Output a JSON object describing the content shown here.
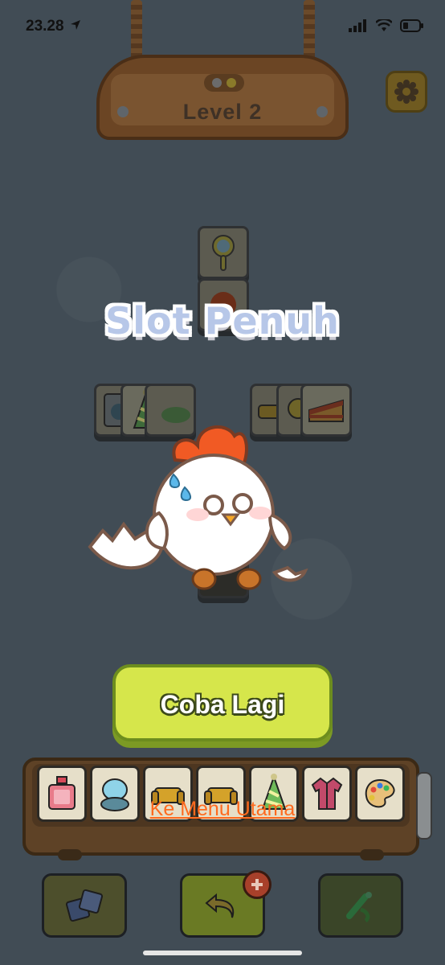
{
  "status_bar": {
    "time": "23.28"
  },
  "header": {
    "level_label": "Level 2"
  },
  "overlay": {
    "title": "Slot Penuh",
    "retry_button": "Coba Lagi",
    "menu_link": "Ke Menu Utama"
  },
  "tray": {
    "items": [
      "perfume-icon",
      "mirror-icon",
      "sofa-icon",
      "sofa-icon",
      "party-hat-icon",
      "shirt-icon",
      "palette-icon"
    ]
  },
  "bottom_bar": {
    "buttons": [
      "shuffle-icon",
      "undo-icon",
      "hint-icon"
    ]
  },
  "colors": {
    "accent_green": "#d6e64b",
    "link_orange": "#ff6a1e",
    "title_blue": "#b7c7e8"
  }
}
